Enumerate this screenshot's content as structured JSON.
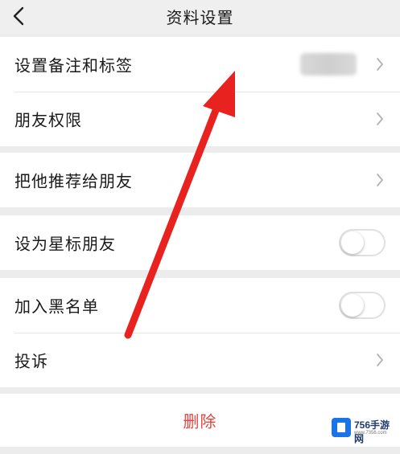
{
  "header": {
    "title": "资料设置",
    "back_icon": "chevron-left-icon"
  },
  "group1": {
    "items": [
      {
        "label": "设置备注和标签",
        "value_blurred": true,
        "icon": "chevron-right-icon"
      },
      {
        "label": "朋友权限",
        "icon": "chevron-right-icon"
      }
    ]
  },
  "group2": {
    "items": [
      {
        "label": "把他推荐给朋友",
        "icon": "chevron-right-icon"
      }
    ]
  },
  "group3": {
    "items": [
      {
        "label": "设为星标朋友",
        "toggle_on": false
      }
    ]
  },
  "group4": {
    "items": [
      {
        "label": "加入黑名单",
        "toggle_on": false
      },
      {
        "label": "投诉",
        "icon": "chevron-right-icon"
      }
    ]
  },
  "actions": {
    "delete_label": "删除",
    "delete_color": "#e64340"
  },
  "annotation": {
    "arrow_color": "#e8221f"
  },
  "watermark": {
    "name": "756手游网",
    "sub": "www.7356.com"
  },
  "colors": {
    "background": "#ececec",
    "row": "#ffffff",
    "text": "#1a1a1a"
  }
}
